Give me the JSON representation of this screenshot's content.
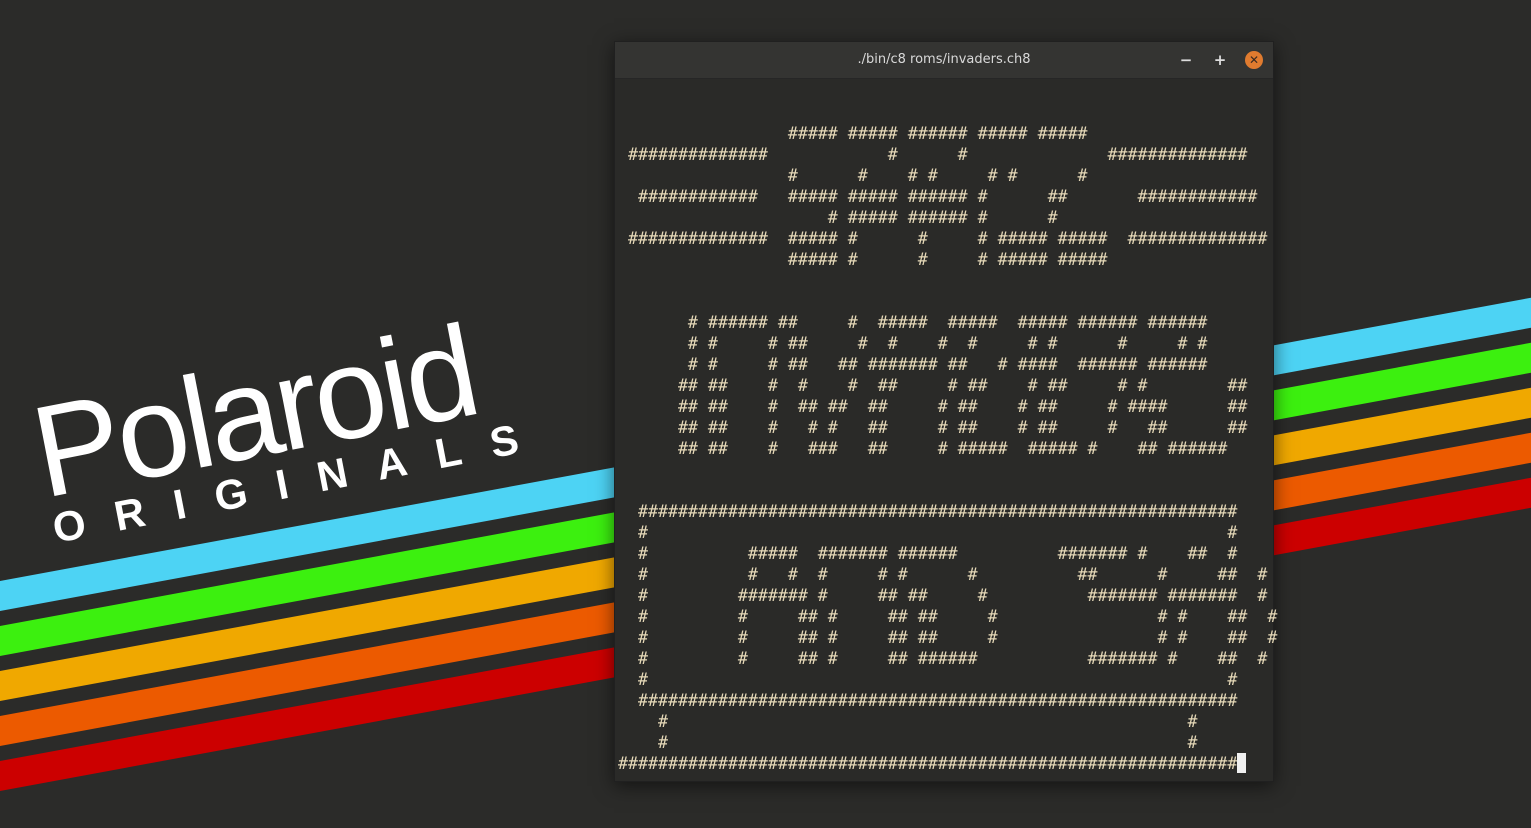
{
  "wallpaper": {
    "logo_word": "Polaroid",
    "logo_sub": "ORIGINALS",
    "stripe_colors": [
      "#4dd3f4",
      "#3cf00f",
      "#f0a800",
      "#ec5a00",
      "#cc0000"
    ]
  },
  "window": {
    "title": "./bin/c8 roms/invaders.ch8",
    "minimize_icon": "−",
    "maximize_icon": "+",
    "close_icon": "✕",
    "terminal_lines": [
      "",
      "                 ##### ##### ###### ##### #####",
      " ##############            #      #              ##############",
      "                 #      #    # #     # #      #",
      "  ############   ##### ##### ###### #      ##       ############",
      "                     # ##### ###### #      #",
      " ##############  ##### #      #     # ##### #####  ##############",
      "                 ##### #      #     # ##### #####",
      "",
      "",
      "       # ###### ##     #  #####  #####  ##### ###### ######",
      "       # #     # ##     #  #    #  #     # #      #     # #",
      "       # #     # ##   ## ####### ##   # ####  ###### ######",
      "      ## ##    #  #    #  ##     # ##    # ##     # #        ##",
      "      ## ##    #  ## ##  ##     # ##    # ##     # ####      ##",
      "      ## ##    #   # #   ##     # ##    # ##     #   ##      ##",
      "      ## ##    #   ###   ##     # #####  ##### #    ## ######",
      "",
      "",
      "  ############################################################",
      "  #                                                          #",
      "  #          #####  ####### ######          ####### #    ##  #",
      "  #          #   #  #     # #      #          ##      #     ##  #",
      "  #         ####### #     ## ##     #          ####### #######  #",
      "  #         #     ## #     ## ##     #                # #    ##  #",
      "  #         #     ## #     ## ##     #                # #    ##  #",
      "  #         #     ## #     ## ######           ####### #    ##  #",
      "  #                                                          #",
      "  ############################################################",
      "    #                                                    #",
      "    #                                                    #",
      "##############################################################"
    ]
  }
}
